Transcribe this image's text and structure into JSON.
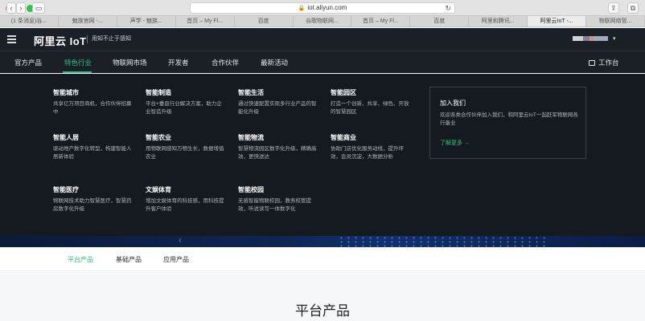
{
  "browser": {
    "address": "iot.aliyun.com",
    "tabs": [
      "(1 条消息)谷...",
      "魅族官网 -...",
      "声学 - 魅族...",
      "首页 – My Fl...",
      "百度",
      "谷歌物联网...",
      "首页 – My Fl...",
      "百度",
      "阿里和腾讯...",
      "阿里云IoT -...",
      "物联网络管..."
    ],
    "active_tab_index": 9
  },
  "header": {
    "logo": "阿里云 IoT",
    "slogan": "用知不止于感知"
  },
  "nav": {
    "items": [
      "官方产品",
      "特色行业",
      "物联网市场",
      "开发者",
      "合作伙伴",
      "最新活动"
    ],
    "active_index": 1,
    "workbench": "工作台"
  },
  "mega": {
    "categories": [
      {
        "title": "智能城市",
        "desc": "共享亿万项目商机，合作伙伴招募中"
      },
      {
        "title": "智能制造",
        "desc": "平台+垂直行业解决方案，助力企业智造升级"
      },
      {
        "title": "智能生活",
        "desc": "通过快速配置实现多行业产品的智能化升级"
      },
      {
        "title": "智能园区",
        "desc": "打造一个创新、共享、绿色、开放的智慧园区"
      },
      {
        "title": "智能人居",
        "desc": "驱动地产数字化转型，构建智能人居新体验"
      },
      {
        "title": "智能农业",
        "desc": "用物联网感知万物生长，数据增值农业"
      },
      {
        "title": "智能物流",
        "desc": "智慧物流园区数字化升级，精确高效，更快送达"
      },
      {
        "title": "智能商业",
        "desc": "协助门店优化服务动线，提升坪效，会员沉淀，大数据分析"
      },
      {
        "title": "智能医疗",
        "desc": "物联网技术助力智慧医疗，智慧药房数字化升级"
      },
      {
        "title": "文娱体育",
        "desc": "增加文娱体育的科技感，用科技提升客户体验"
      },
      {
        "title": "智能校园",
        "desc": "无感智能物联校园，教务校管提效，听说读写一体数字化"
      }
    ],
    "join": {
      "title": "加入我们",
      "desc": "欢迎各类合作伙伴加入我们，和阿里云IoT一起赶军物联网各行备业",
      "link": "了解更多 →"
    }
  },
  "subtabs": {
    "items": [
      "平台产品",
      "基础产品",
      "应用产品"
    ],
    "active_index": 0
  },
  "main": {
    "section_title": "平台产品"
  },
  "colors": {
    "accent": "#31c27c",
    "dark_bg": "#151a21"
  }
}
